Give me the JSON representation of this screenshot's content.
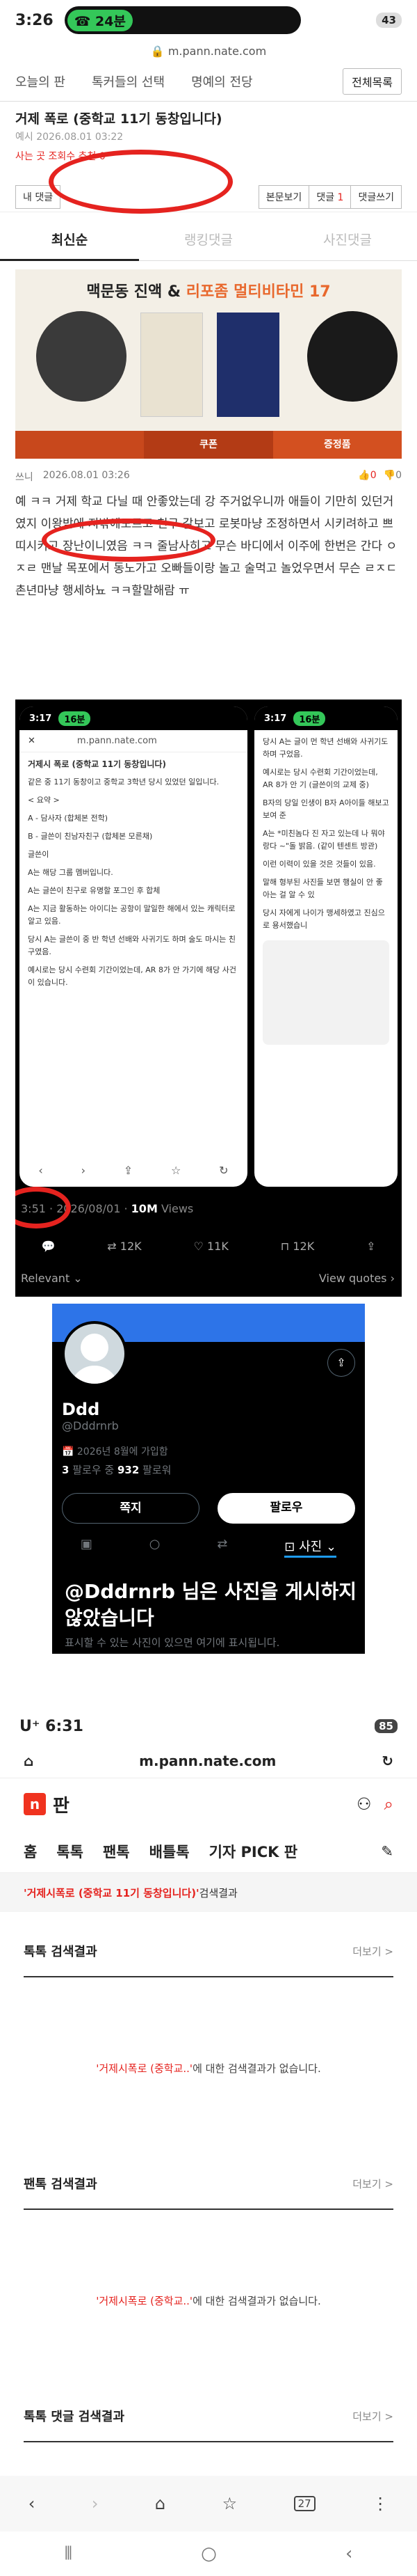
{
  "s1": {
    "status": {
      "time": "3:26",
      "call": "24분",
      "battery": "43"
    },
    "url": "m.pann.nate.com",
    "top_tabs": [
      "오늘의 판",
      "톡커들의 선택",
      "명예의 전당"
    ],
    "full_list_button": "전체목록",
    "post_title": "거제 폭로 (중학교 11기 동창입니다)",
    "post_meta1": "예시 2026.08.01 03:22",
    "post_meta2": "사는 곳 조회수 추천 0",
    "my_comments": "내 댓글",
    "btn_body": "본문보기",
    "btn_comments_label": "댓글",
    "btn_comments_count": "1",
    "btn_write": "댓글쓰기",
    "comment_tabs": [
      "최신순",
      "랭킹댓글",
      "사진댓글"
    ],
    "ad": {
      "headline_a": "맥문동 진액 & ",
      "headline_b": "리포좀 멀티비타민 17",
      "foot_center": "쿠폰",
      "foot_right": "증정품"
    },
    "comment": {
      "author": "쓰니",
      "date": "2026.08.01 03:26",
      "up": "0",
      "down": "0",
      "text": "예 ㅋㅋ 거제 학교 다닐 때 안좋았는데 강 주거없우니까 애들이 기만히 있던거였지 이왕받에 지밖에모르고 친구 갈보고 로봇마냥 조정하면서 시키려하고 쁘띠시키고 장난이니였음 ㅋㅋ 줄남사히고 무슨 바디에서 이주에 한번은 간다 ㅇㅈㄹ 맨날 목포에서 동노가고 오빠들이랑 놀고 술먹고 놀었우면서 무슨 ㄹㅈㄷ 촌년마냥 행세하뇨 ㅋㅋ할말해람 ㅠ"
    }
  },
  "s2": {
    "left_phone": {
      "time": "3:17",
      "call": "16분",
      "url": "m.pann.nate.com",
      "title": "거제시 폭로 (중학교 11기 동창입니다)",
      "lines": [
        "같은 중 11기 동창이고 중학교 3학년 당시 있었던 일입니다.",
        "< 요약 >",
        "A - 담사자 (합체본 전학)",
        "B - 글쓴이 친남자친구 (합체본 모른채)",
        "글쓴이",
        "A는 해당 그룹 멤버입니다.",
        "A는 글쓴이 친구로 유명할 포그인 후 합체",
        "A는 지금 활동하는 아이디는 공항이 말일한 해에서 있는 캐릭터로 알고 있음.",
        "당시 A는 글쓴이 중 반 학년 선배와 사귀기도 하며 술도 마시는 친구였음.",
        "예시로는 당시 수련회 기간이었는데, AR 8가 안 가기에 해당 사건이 있습니다."
      ]
    },
    "right_phone": {
      "time": "3:17",
      "call": "16분",
      "lines": [
        "당시 A는 글이 먼 학년 선배와 사귀기도 하며 구었음.",
        "예시로는 당시 수련회 기간이었는데, AR 8가 안 기 (글쓴이의 교제 중)",
        "B자의 당일 인생이 B자 A아이들 해보고 보여 준",
        "A는 *미친놈다 진 자고 있는데 나 뭐야랑다 ~\"돌 밝음. (같이 텐센트 방관)",
        "이런 이력이 있을 것은 것들이 있음.",
        "말해 형부된 사진들 보면 행실이 안 좋아는 걸 알 수 있",
        "당시 자에게 나이가 맹세하였고 진심으로 용서했습니"
      ]
    },
    "tweet_meta": "3:51 · 2026/08/01 · ",
    "views_count": "10M",
    "views_label": " Views",
    "retweets": "12K",
    "likes": "11K",
    "bookmarks": "12K",
    "relevant": "Relevant",
    "view_quotes": "View quotes"
  },
  "s3": {
    "name": "Ddd",
    "handle": "@Dddrnrb",
    "joined": "2026년 8월에 가입함",
    "following": "3",
    "following_label": " 팔로우 중 ",
    "followers": "932",
    "followers_label": " 팔로워",
    "btn_dm": "쪽지",
    "btn_follow": "팔로우",
    "photo_tab": "사진",
    "empty_title": "@Dddrnrb 님은 사진을 게시하지 않았습니다",
    "empty_sub": "표시할 수 있는 사진이 있으면 여기에 표시됩니다."
  },
  "s4": {
    "status": {
      "carrier": "U⁺",
      "time": "6:31",
      "battery": "85"
    },
    "url": "m.pann.nate.com",
    "logo": "판",
    "nav": [
      "홈",
      "톡톡",
      "팬톡",
      "배틀톡",
      "기자 PICK 판"
    ],
    "query": "'거제시폭로 (중학교 11기 동창입니다)'",
    "query_suffix": " 검색결과",
    "sections": [
      {
        "title": "톡톡 검색결과",
        "more": "더보기 >"
      },
      {
        "title": "팬톡 검색결과",
        "more": "더보기 >"
      },
      {
        "title": "톡톡 댓글 검색결과",
        "more": "더보기 >"
      }
    ],
    "empty_query": "'거제시폭로 (중학교..'",
    "empty_suffix": "에 대한 검색결과가 없습니다.",
    "tab_count": "27"
  },
  "colors": {
    "red": "#e5231f",
    "green": "#34c759"
  }
}
